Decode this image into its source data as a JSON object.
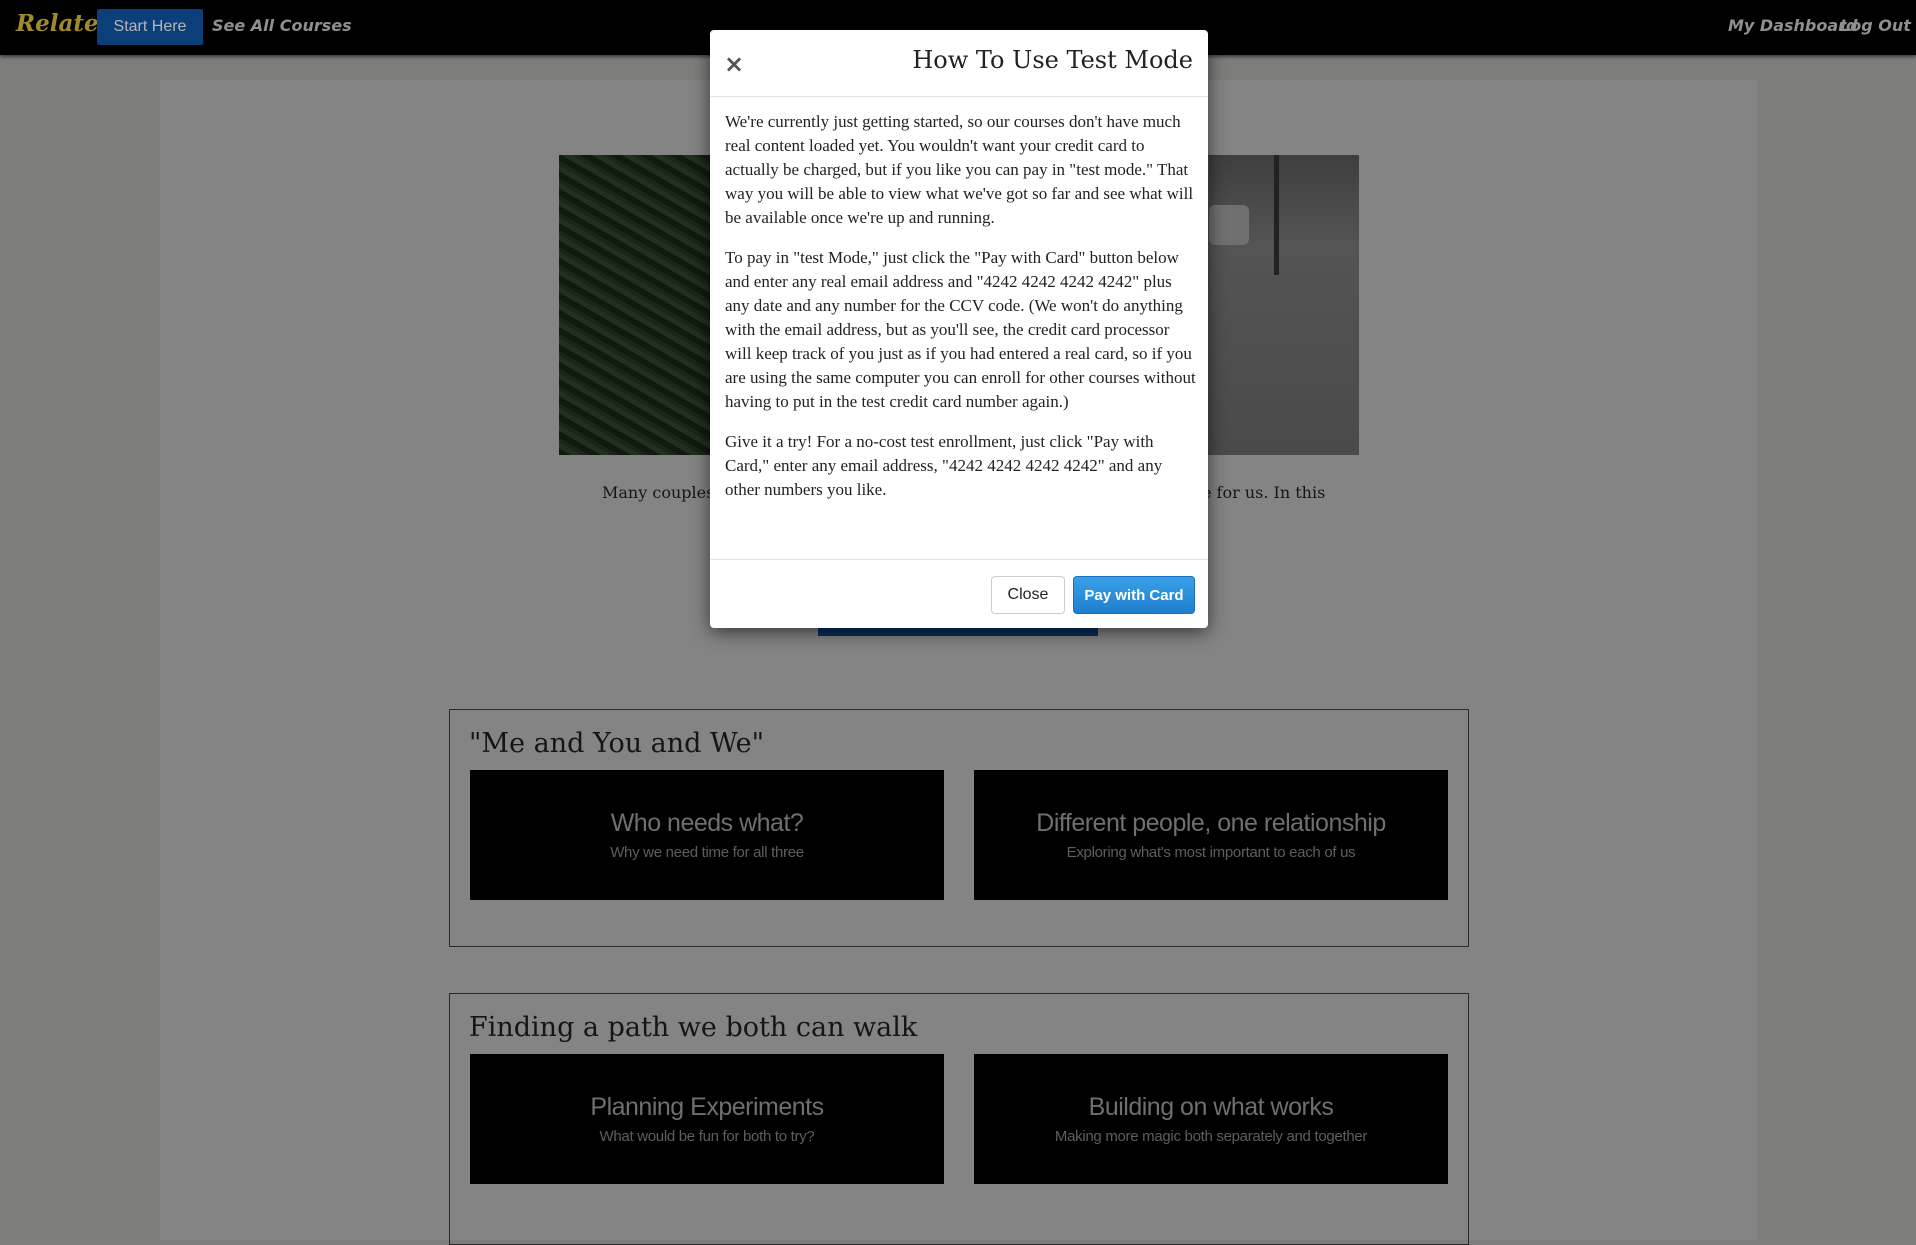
{
  "nav": {
    "brand": "Relate!",
    "start_here": "Start Here",
    "see_all_courses": "See All Courses",
    "my_dashboard": "My Dashboard",
    "log_out": "Log Out"
  },
  "intro": {
    "left_fragment": "Many couples s",
    "right_fragment": "e for us. In this"
  },
  "sections": [
    {
      "title": "\"Me and You and We\"",
      "cards": [
        {
          "title": "Who needs what?",
          "subtitle": "Why we need time for all three"
        },
        {
          "title": "Different people, one relationship",
          "subtitle": "Exploring what's most important to each of us"
        }
      ]
    },
    {
      "title": "Finding a path we both can walk",
      "cards": [
        {
          "title": "Planning Experiments",
          "subtitle": "What would be fun for both to try?"
        },
        {
          "title": "Building on what works",
          "subtitle": "Making more magic both separately and together"
        }
      ]
    }
  ],
  "modal": {
    "close_x": "×",
    "title": "How To Use Test Mode",
    "paragraphs": [
      "We're currently just getting started, so our courses don't have much real content loaded yet. You wouldn't want your credit card to actually be charged, but if you like you can pay in \"test mode.\" That way you will be able to view what we've got so far and see what will be available once we're up and running.",
      "To pay in \"test Mode,\" just click the \"Pay with Card\" button below and enter any real email address and \"4242 4242 4242 4242\" plus any date and any number for the CCV code. (We won't do anything with the email address, but as you'll see, the credit card processor will keep track of you just as if you had entered a real card, so if you are using the same computer you can enroll for other courses without having to put in the test credit card number again.)",
      "Give it a try! For a no-cost test enrollment, just click \"Pay with Card,\" enter any email address, \"4242 4242 4242 4242\" and any other numbers you like."
    ],
    "close_button": "Close",
    "pay_button": "Pay with Card"
  }
}
